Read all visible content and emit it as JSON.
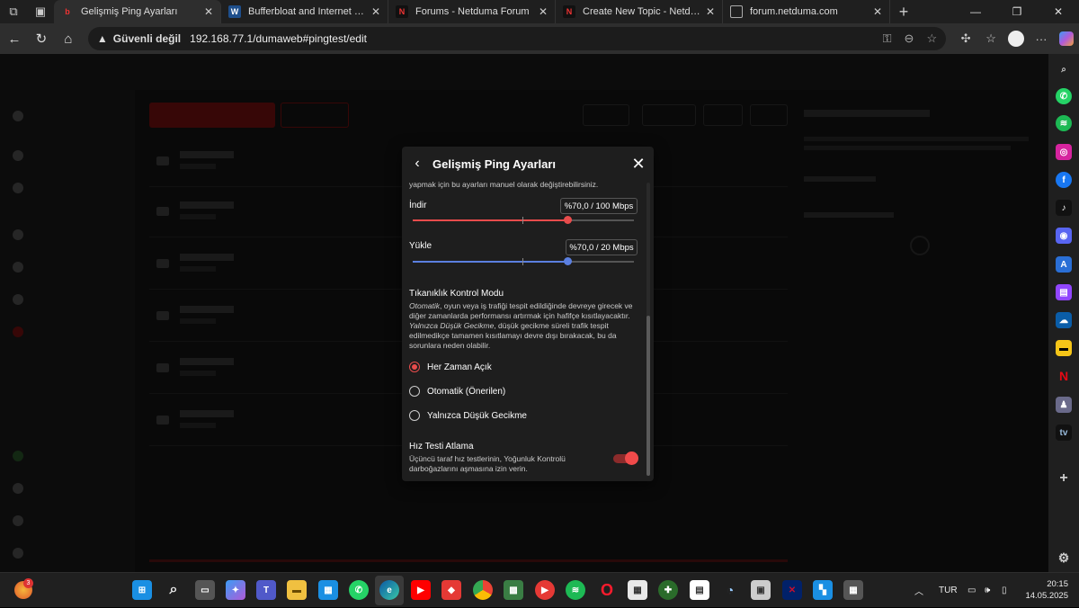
{
  "browser": {
    "tabs": [
      {
        "title": "Gelişmiş Ping Ayarları",
        "favicon": "netduma-icon",
        "active": true
      },
      {
        "title": "Bufferbloat and Internet Speed Te",
        "favicon": "waveform-icon",
        "active": false
      },
      {
        "title": "Forums - Netduma Forum",
        "favicon": "netduma-icon",
        "active": false
      },
      {
        "title": "Create New Topic - Netduma Foru",
        "favicon": "netduma-icon",
        "active": false
      },
      {
        "title": "forum.netduma.com",
        "favicon": "page-icon",
        "active": false
      }
    ],
    "security_label": "Güvenli değil",
    "url": "192.168.77.1/dumaweb#pingtest/edit"
  },
  "modal": {
    "title": "Gelişmiş Ping Ayarları",
    "intro_text": "yapmak için bu ayarları manuel olarak değiştirebilirsiniz.",
    "download": {
      "label": "İndir",
      "value_text": "%70,0 / 100 Mbps",
      "percent": 70,
      "color": "#e84c4c"
    },
    "upload": {
      "label": "Yükle",
      "value_text": "%70,0 / 20 Mbps",
      "percent": 70,
      "color": "#5b7fe0"
    },
    "congestion": {
      "heading": "Tıkanıklık Kontrol Modu",
      "desc_auto_em": "Otomatik",
      "desc_auto": ", oyun veya iş trafiği tespit edildiğinde devreye girecek ve diğer zamanlarda performansı artırmak için hafifçe kısıtlayacaktır.",
      "desc_low_em": "Yalnızca Düşük Gecikme",
      "desc_low": ", düşük gecikme süreli trafik tespit edilmedikçe tamamen kısıtlamayı devre dışı bırakacak, bu da sorunlara neden olabilir.",
      "options": [
        "Her Zaman Açık",
        "Otomatik (Önerilen)",
        "Yalnızca Düşük Gecikme"
      ],
      "selected": 0
    },
    "speedtest_bypass": {
      "heading": "Hız Testi Atlama",
      "desc": "Üçüncü taraf hız testlerinin, Yoğunluk Kontrolü darboğazlarını aşmasına izin verin.",
      "enabled": true
    }
  },
  "taskbar": {
    "language": "TUR",
    "time": "20:15",
    "date": "14.05.2025",
    "notification_badge": "3"
  },
  "colors": {
    "accent": "#e84c4c",
    "upload": "#5b7fe0"
  }
}
